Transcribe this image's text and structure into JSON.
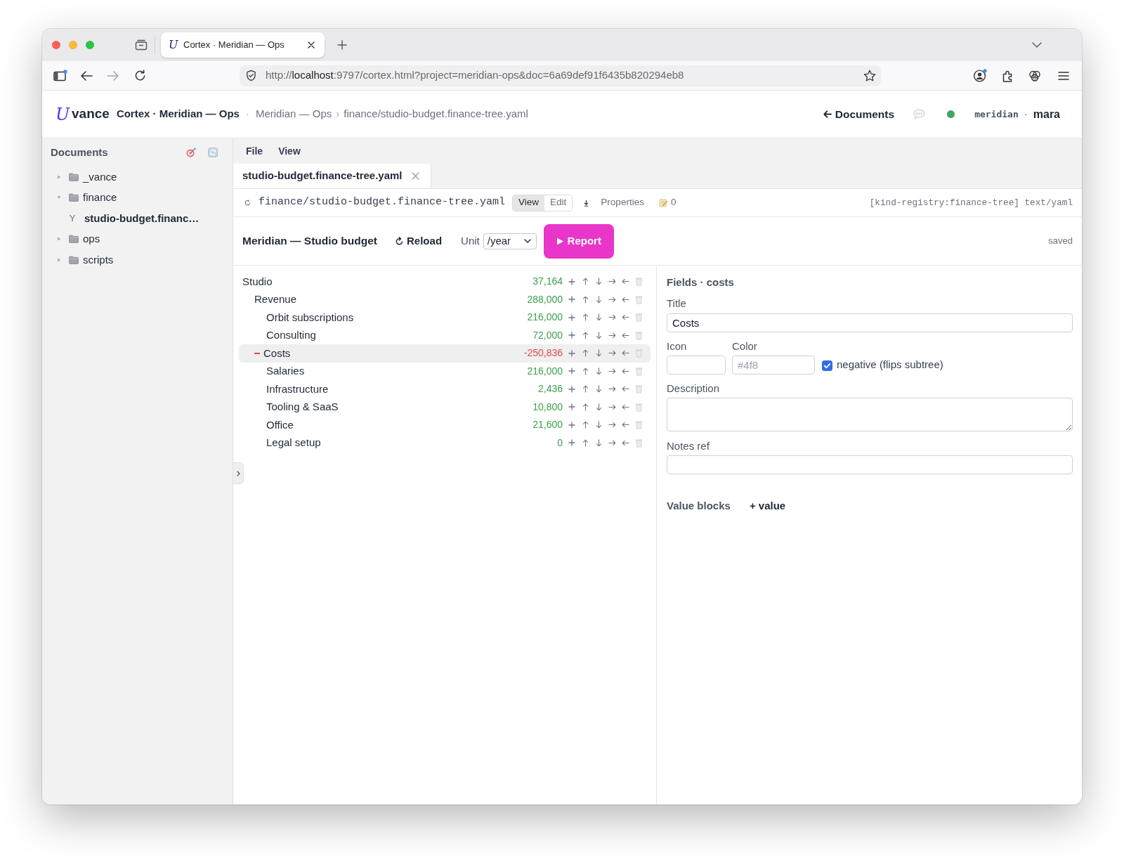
{
  "browser": {
    "tab_mark": "U",
    "tab_title": "Cortex · Meridian — Ops",
    "url": "http://**localhost**:9797/cortex.html?project=meridian-ops&doc=6a69def91f6435b820294eb8"
  },
  "header": {
    "mark": "U",
    "brand": "vance",
    "project": "Cortex · Meridian — Ops",
    "divider": "·",
    "crumbs": [
      "Meridian — Ops",
      "finance/studio-budget.finance-tree.yaml"
    ],
    "crumb_separator": "›",
    "back_link": "Documents",
    "online": true,
    "workspace": "meridian",
    "user_separator": "·",
    "user": "mara"
  },
  "sidebar": {
    "title": "Documents",
    "items": [
      {
        "kind": "folder",
        "label": "_vance",
        "expanded": false,
        "selected": false
      },
      {
        "kind": "folder",
        "label": "finance",
        "expanded": true,
        "selected": false,
        "children": [
          {
            "kind": "file",
            "glyph": "Y",
            "label": "studio-budget.financ…",
            "selected": true
          }
        ]
      },
      {
        "kind": "folder",
        "label": "ops",
        "expanded": false,
        "selected": false
      },
      {
        "kind": "folder",
        "label": "scripts",
        "expanded": false,
        "selected": false
      }
    ]
  },
  "menu": [
    "File",
    "View"
  ],
  "editor_tabs": [
    {
      "label": "studio-budget.finance-tree.yaml",
      "selected": true
    }
  ],
  "path_bar": {
    "path": "finance/studio-budget.finance-tree.yaml",
    "modes": [
      {
        "label": "View",
        "selected": true
      },
      {
        "label": "Edit",
        "selected": false
      }
    ],
    "properties": "Properties",
    "notes_count": "0",
    "meta": "[kind-registry:finance-tree] text/yaml"
  },
  "toolbar": {
    "title": "Meridian — Studio budget",
    "reload": "Reload",
    "unit_label": "Unit",
    "unit": "/year",
    "report": "Report",
    "status": "saved"
  },
  "tree": {
    "nodes": [
      {
        "name": "Studio",
        "value": "37,164",
        "negative": false,
        "selected": false,
        "children": [
          {
            "name": "Revenue",
            "value": "288,000",
            "negative": false,
            "selected": false,
            "children": [
              {
                "name": "Orbit subscriptions",
                "value": "216,000",
                "negative": false,
                "selected": false
              },
              {
                "name": "Consulting",
                "value": "72,000",
                "negative": false,
                "selected": false
              }
            ]
          },
          {
            "name": "Costs",
            "value": "-250,836",
            "negative": true,
            "selected": true,
            "children": [
              {
                "name": "Salaries",
                "value": "216,000",
                "negative": false,
                "selected": false
              },
              {
                "name": "Infrastructure",
                "value": "2,436",
                "negative": false,
                "selected": false
              },
              {
                "name": "Tooling & SaaS",
                "value": "10,800",
                "negative": false,
                "selected": false
              },
              {
                "name": "Office",
                "value": "21,600",
                "negative": false,
                "selected": false
              },
              {
                "name": "Legal setup",
                "value": "0",
                "negative": false,
                "selected": false
              }
            ]
          }
        ]
      }
    ]
  },
  "fields": {
    "heading": "Fields · costs",
    "title": {
      "label": "Title",
      "value": "Costs"
    },
    "icon": {
      "label": "Icon"
    },
    "color": {
      "label": "Color",
      "placeholder": "#4f8"
    },
    "negative": {
      "label": "negative (flips subtree)",
      "checked": true
    },
    "description": {
      "label": "Description"
    },
    "notes_ref": {
      "label": "Notes ref"
    },
    "value_blocks": {
      "label": "Value blocks",
      "add": "+ value"
    }
  }
}
